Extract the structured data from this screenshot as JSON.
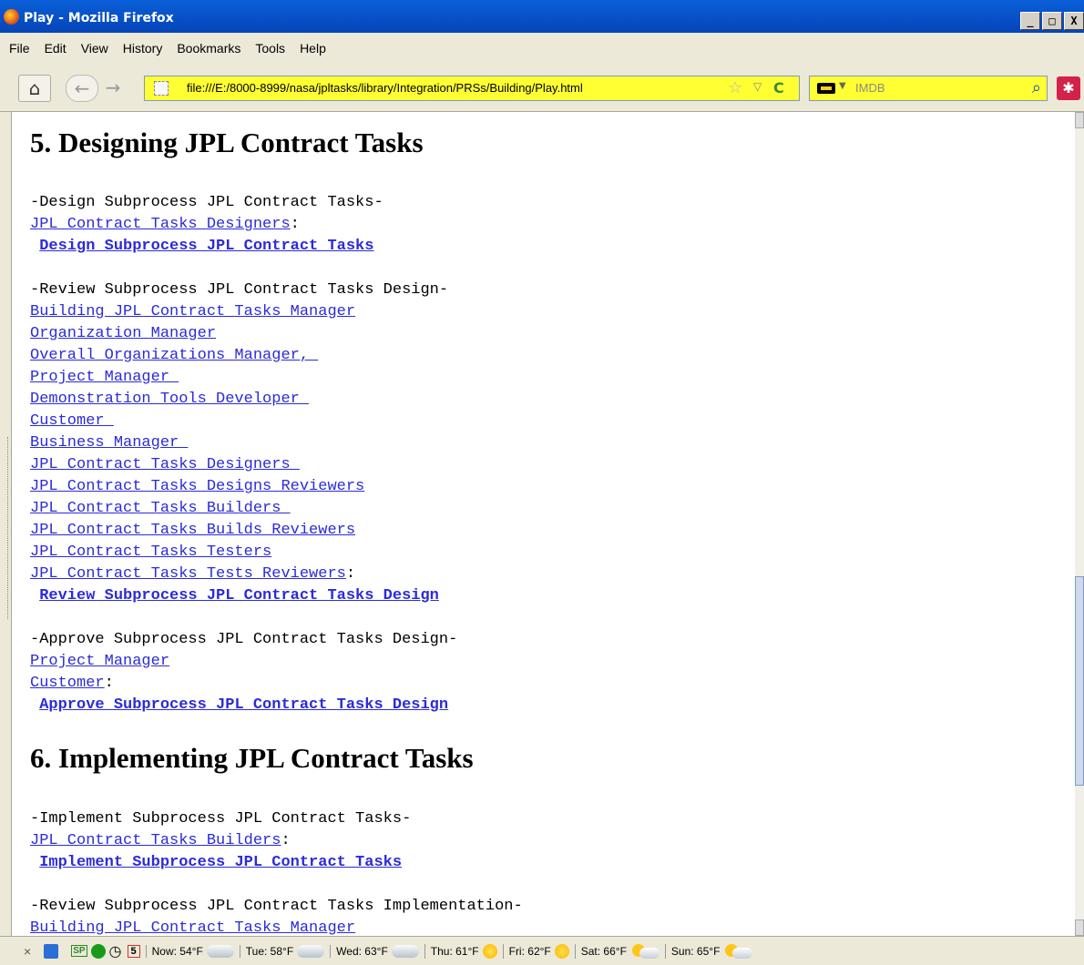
{
  "window": {
    "title": "Play - Mozilla Firefox"
  },
  "window_buttons": {
    "minimize": "_",
    "maximize": "□",
    "close": "X"
  },
  "menu": [
    "File",
    "Edit",
    "View",
    "History",
    "Bookmarks",
    "Tools",
    "Help"
  ],
  "nav": {
    "url": "file:///E:/8000-8999/nasa/jpltasks/library/Integration/PRSs/Building/Play.html",
    "search_placeholder": "IMDB",
    "home_glyph": "⌂",
    "back_glyph": "←",
    "forward_glyph": "→",
    "star_glyph": "☆",
    "drop_glyph": "▽",
    "reload_glyph": "C",
    "search_drop_glyph": "▼",
    "search_glyph": "⌕",
    "addon_glyph": "✱"
  },
  "content": {
    "section5_title": "5. Designing JPL Contract Tasks",
    "design_header": "-Design Subprocess JPL Contract Tasks-",
    "design_role": "JPL Contract Tasks Designers",
    "design_colon": ":",
    "design_action": "Design Subprocess JPL Contract Tasks",
    "review_header": "-Review Subprocess JPL Contract Tasks Design-",
    "review_roles": [
      "Building JPL Contract Tasks Manager",
      "Organization Manager",
      "Overall Organizations Manager, ",
      "Project Manager ",
      "Demonstration Tools Developer ",
      "Customer ",
      "Business Manager ",
      "JPL Contract Tasks Designers ",
      "JPL Contract Tasks Designs Reviewers",
      "JPL Contract Tasks Builders ",
      "JPL Contract Tasks Builds Reviewers",
      "JPL Contract Tasks Testers",
      "JPL Contract Tasks Tests Reviewers"
    ],
    "review_colon": ":",
    "review_action": "Review Subprocess JPL Contract Tasks Design",
    "approve_header": "-Approve Subprocess JPL Contract Tasks Design-",
    "approve_roles": [
      "Project Manager",
      "Customer"
    ],
    "approve_colon": ":",
    "approve_action": "Approve Subprocess JPL Contract Tasks Design",
    "section6_title": "6. Implementing JPL Contract Tasks",
    "implement_header": "-Implement Subprocess JPL Contract Tasks-",
    "implement_role": "JPL Contract Tasks Builders",
    "implement_colon": ":",
    "implement_action": "Implement Subprocess JPL Contract Tasks",
    "review_impl_header": "-Review Subprocess JPL Contract Tasks Implementation-",
    "review_impl_first": "Building JPL Contract Tasks Manager"
  },
  "statusbar": {
    "close_glyph": "×",
    "clock_glyph": "◷",
    "calendar_day": "5",
    "sp_label": "SP",
    "now": "Now: 54°F",
    "tue": "Tue: 58°F",
    "wed": "Wed: 63°F",
    "thu": "Thu: 61°F",
    "fri": "Fri: 62°F",
    "sat": "Sat: 66°F",
    "sun": "Sun: 65°F"
  },
  "colors": {
    "link": "#2b2bd9",
    "titlebar": "#0a5fd8",
    "url_bg": "#ffff33"
  }
}
